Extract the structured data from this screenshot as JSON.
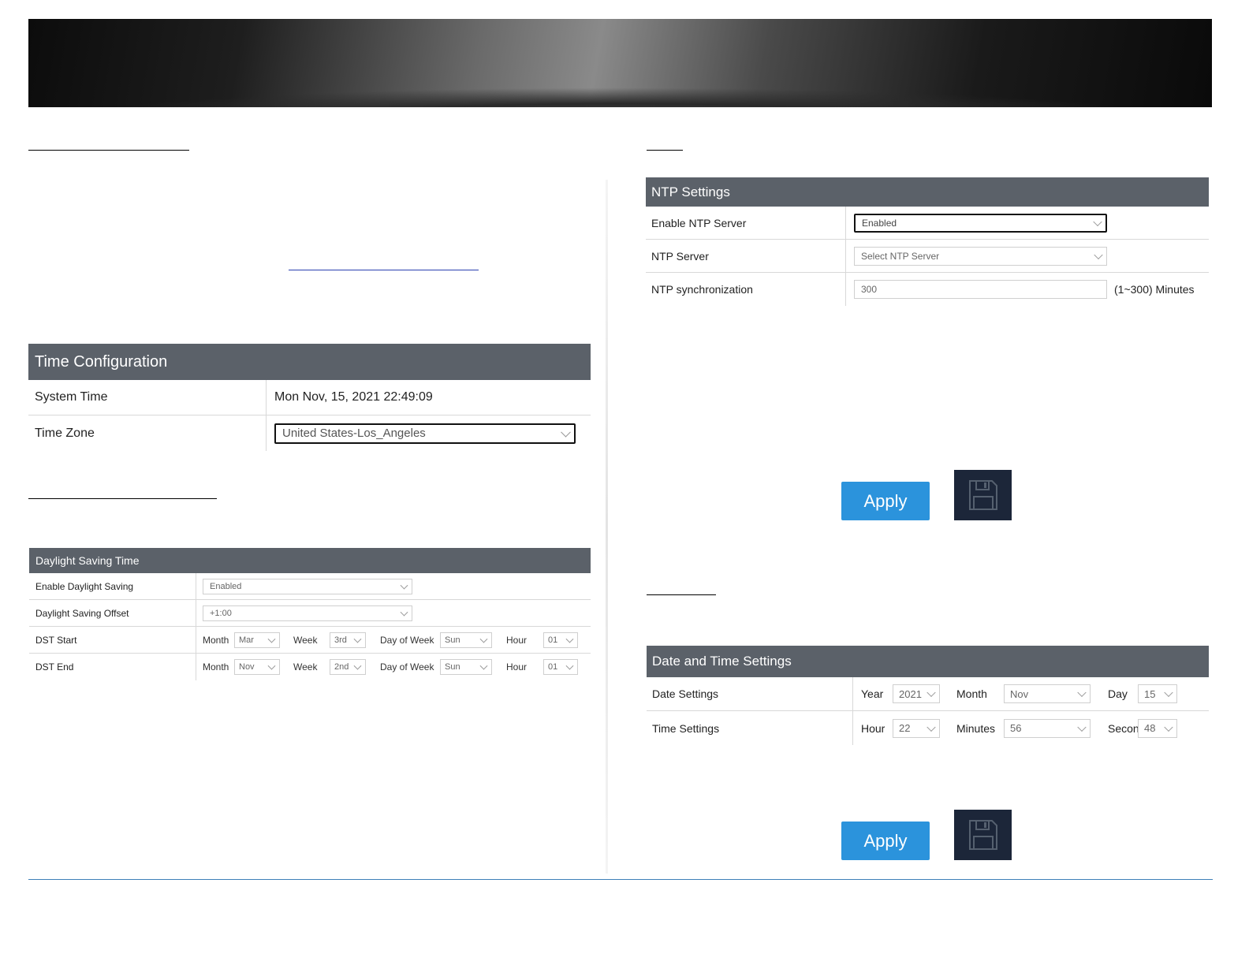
{
  "time_config": {
    "title": "Time Configuration",
    "system_time_label": "System Time",
    "system_time_value": "Mon Nov, 15, 2021 22:49:09",
    "time_zone_label": "Time Zone",
    "time_zone_value": "United States-Los_Angeles"
  },
  "dst": {
    "title": "Daylight Saving Time",
    "enable_label": "Enable Daylight Saving",
    "enable_value": "Enabled",
    "offset_label": "Daylight Saving Offset",
    "offset_value": "+1:00",
    "start_label": "DST Start",
    "end_label": "DST End",
    "month_label": "Month",
    "week_label": "Week",
    "dow_label": "Day of Week",
    "hour_label": "Hour",
    "start": {
      "month": "Mar",
      "week": "3rd",
      "dow": "Sun",
      "hour": "01"
    },
    "end": {
      "month": "Nov",
      "week": "2nd",
      "dow": "Sun",
      "hour": "01"
    }
  },
  "ntp": {
    "title": "NTP Settings",
    "enable_label": "Enable NTP Server",
    "enable_value": "Enabled",
    "server_label": "NTP Server",
    "server_value": "Select NTP Server",
    "sync_label": "NTP synchronization",
    "sync_value": "300",
    "sync_unit": "(1~300) Minutes",
    "apply_label": "Apply"
  },
  "datetime": {
    "title": "Date and Time Settings",
    "date_label": "Date Settings",
    "time_label": "Time Settings",
    "year_label": "Year",
    "year_value": "2021",
    "month_label": "Month",
    "month_value": "Nov",
    "day_label": "Day",
    "day_value": "15",
    "hour_label": "Hour",
    "hour_value": "22",
    "minutes_label": "Minutes",
    "minutes_value": "56",
    "second_label": "Second",
    "second_value": "48",
    "apply_label": "Apply"
  },
  "icons": {
    "save": "floppy-disk-icon",
    "dropdown": "chevron-down-icon"
  },
  "colors": {
    "header_bg": "#5b6169",
    "apply_bg": "#2b93dc",
    "save_bg": "#1c2639",
    "bottom_rule": "#3d7fb8"
  }
}
